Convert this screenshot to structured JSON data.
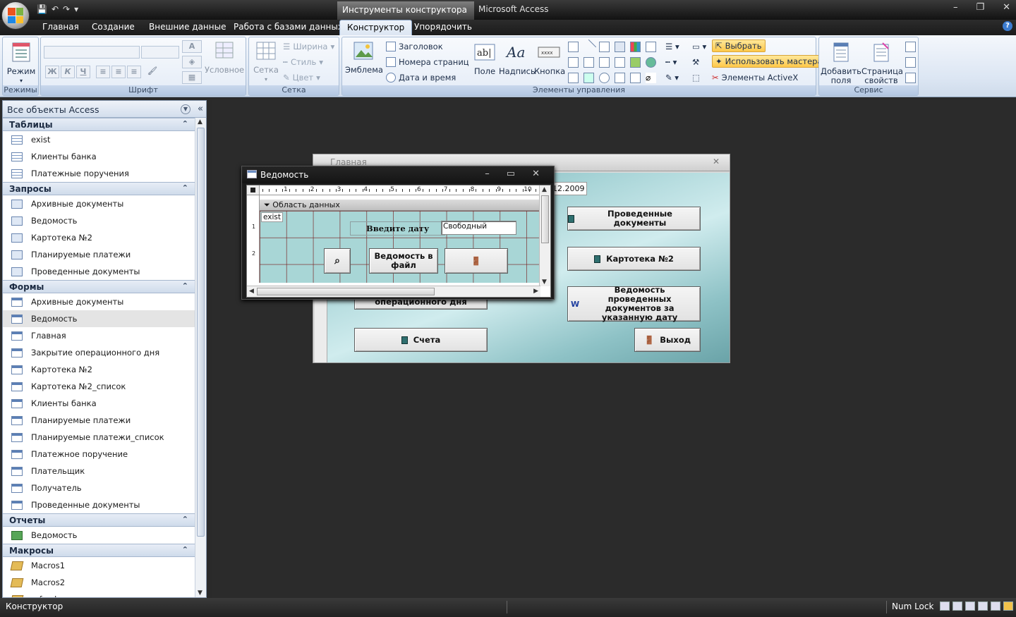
{
  "window": {
    "context_tab_label": "Инструменты конструктора форм",
    "app_title": "Microsoft Access",
    "minimize": "–",
    "maximize": "❐",
    "close": "✕"
  },
  "qat": {
    "save": "💾",
    "undo": "↶",
    "redo": "↷",
    "more": "▾"
  },
  "tabs": [
    {
      "label": "Главная"
    },
    {
      "label": "Создание"
    },
    {
      "label": "Внешние данные"
    },
    {
      "label": "Работа с базами данных"
    },
    {
      "label": "Конструктор"
    },
    {
      "label": "Упорядочить"
    }
  ],
  "ribbon": {
    "modes": {
      "label": "Режимы",
      "view": "Режим"
    },
    "font": {
      "label": "Шрифт",
      "conditional": "Условное",
      "bold": "Ж",
      "italic": "К",
      "underline": "Ч"
    },
    "grid": {
      "label": "Сетка",
      "grid_btn": "Сетка",
      "width": "Ширина",
      "style": "Стиль",
      "color": "Цвет"
    },
    "controls": {
      "label": "Элементы управления",
      "logo": "Эмблема",
      "title": "Заголовок",
      "page_numbers": "Номера страниц",
      "date_time": "Дата и время",
      "field": "Поле",
      "label_ctl": "Надпись",
      "button": "Кнопка",
      "select": "Выбрать",
      "use_wizard": "Использовать мастера",
      "activex": "Элементы ActiveX"
    },
    "tools": {
      "label": "Сервис",
      "add_fields": "Добавить поля",
      "property_sheet": "Страница свойств"
    }
  },
  "nav": {
    "header": "Все объекты Access",
    "sections": {
      "tables": {
        "title": "Таблицы",
        "items": [
          "exist",
          "Клиенты банка",
          "Платежные поручения"
        ]
      },
      "queries": {
        "title": "Запросы",
        "items": [
          "Архивные документы",
          "Ведомость",
          "Картотека №2",
          "Планируемые платежи",
          "Проведенные документы"
        ]
      },
      "forms": {
        "title": "Формы",
        "items": [
          "Архивные документы",
          "Ведомость",
          "Главная",
          "Закрытие операционного дня",
          "Картотека №2",
          "Картотека №2_список",
          "Клиенты банка",
          "Планируемые платежи",
          "Планируемые платежи_список",
          "Платежное поручение",
          "Плательщик",
          "Получатель",
          "Проведенные документы"
        ]
      },
      "reports": {
        "title": "Отчеты",
        "items": [
          "Ведомость"
        ]
      },
      "macros": {
        "title": "Макросы",
        "items": [
          "Macros1",
          "Macros2",
          "refresh"
        ]
      }
    }
  },
  "main_form": {
    "title": "Главная",
    "date_fragment": "12.2009",
    "buttons": {
      "conducted": "Проведенные документы",
      "card2": "Картотека №2",
      "statement": "Ведомость проведенных документов за указанную дату",
      "close_day": "операционного дня",
      "accounts": "Счета",
      "exit": "Выход"
    }
  },
  "design_window": {
    "title": "Ведомость",
    "section": "Область данных",
    "field_label": "exist",
    "prompt_label": "Введите дату",
    "textbox_value": "Свободный",
    "export_button": "Ведомость в файл",
    "ruler_marks": [
      "1",
      "2",
      "3",
      "4",
      "5",
      "6",
      "7",
      "8",
      "9",
      "10"
    ],
    "ruler_v": [
      "1",
      "2"
    ]
  },
  "status": {
    "left": "Конструктор",
    "numlock": "Num Lock"
  },
  "colors": {
    "form_accent": "#a6d3d6",
    "highlight": "#ffc84a",
    "grid_line": "#782020"
  }
}
